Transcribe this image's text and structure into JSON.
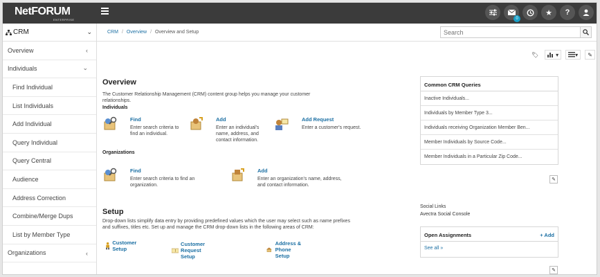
{
  "header": {
    "logo_main": "NetFORUM",
    "logo_sub": "ENTERPRISE",
    "mail_badge": "0"
  },
  "sidebar": {
    "module": "CRM",
    "items": [
      {
        "label": "Overview",
        "kind": "top"
      },
      {
        "label": "Individuals",
        "kind": "top"
      },
      {
        "label": "Find Individual",
        "kind": "sub"
      },
      {
        "label": "List Individuals",
        "kind": "sub"
      },
      {
        "label": "Add Individual",
        "kind": "sub"
      },
      {
        "label": "Query Individual",
        "kind": "sub"
      },
      {
        "label": "Query Central",
        "kind": "sub"
      },
      {
        "label": "Audience",
        "kind": "sub"
      },
      {
        "label": "Address Correction",
        "kind": "sub"
      },
      {
        "label": "Combine/Merge Dups",
        "kind": "sub"
      },
      {
        "label": "List by Member Type",
        "kind": "sub"
      },
      {
        "label": "Organizations",
        "kind": "top"
      }
    ]
  },
  "breadcrumb": [
    "CRM",
    "Overview",
    "Overview and Setup"
  ],
  "search": {
    "placeholder": "Search"
  },
  "overview": {
    "title": "Overview",
    "description": "The Customer Relationship Management (CRM) content group helps you manage your customer relationships.",
    "individuals_heading": "Individuals",
    "organizations_heading": "Organizations",
    "individual_actions": [
      {
        "title": "Find",
        "desc": "Enter search criteria to find an individual."
      },
      {
        "title": "Add",
        "desc": "Enter an individual's name, address, and contact information."
      },
      {
        "title": "Add Request",
        "desc": "Enter a customer's request."
      }
    ],
    "organization_actions": [
      {
        "title": "Find",
        "desc": "Enter search criteria to find an organization."
      },
      {
        "title": "Add",
        "desc": "Enter an organization's name, address, and contact information."
      }
    ]
  },
  "setup": {
    "title": "Setup",
    "description": "Drop-down lists simplify data entry by providing predefined values which the user may select such as name prefixes and suffixes, titles etc. Set up and manage the CRM drop-down lists in the following areas of CRM:",
    "links": [
      "Customer Setup",
      "Customer Request Setup",
      "Address & Phone Setup"
    ]
  },
  "queries": {
    "title": "Common CRM Queries",
    "items": [
      "Inactive Individuals...",
      "Individuals by Member Type 3...",
      "Individuals receiving Organization Member Ben...",
      "Member Individuals by Source Code...",
      "Member Individuals in a Particular Zip Code..."
    ]
  },
  "social": {
    "heading": "Social Links",
    "link": "Avectra Social Console"
  },
  "assignments": {
    "title": "Open Assignments",
    "add_label": "+ Add",
    "see_all": "See all »"
  }
}
